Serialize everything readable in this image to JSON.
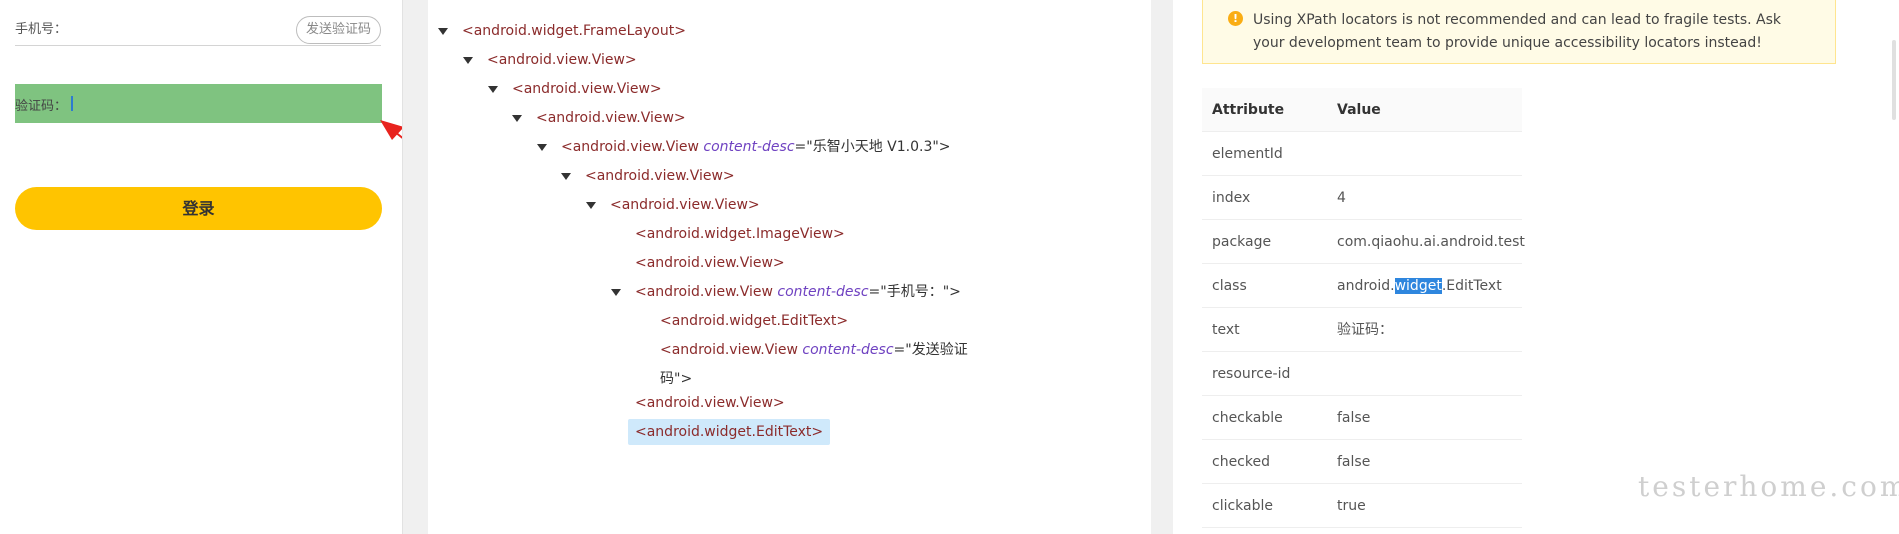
{
  "phone": {
    "phone_label": "手机号：",
    "send_code": "发送验证码",
    "code_label": "验证码：",
    "login": "登录"
  },
  "tree": {
    "rows": [
      {
        "tag": "<android.widget.FrameLayout>"
      },
      {
        "tag": "<android.view.View>"
      },
      {
        "tag": "<android.view.View>"
      },
      {
        "tag": "<android.view.View>"
      },
      {
        "tag_open": "<android.view.View ",
        "attr": "content-desc",
        "eq": "=\"乐智小天地 V1.0.3\">"
      },
      {
        "tag": "<android.view.View>"
      },
      {
        "tag": "<android.view.View>"
      },
      {
        "tag": "<android.widget.ImageView>"
      },
      {
        "tag": "<android.view.View>"
      },
      {
        "tag_open": "<android.view.View ",
        "attr": "content-desc",
        "eq": "=\"手机号：\">"
      },
      {
        "tag": "<android.widget.EditText>"
      },
      {
        "tag_open": "<android.view.View ",
        "attr": "content-desc",
        "eq": "=\"发送验证",
        "eq2": "码\">"
      },
      {
        "tag": "<android.view.View>"
      },
      {
        "tag": "<android.widget.EditText>"
      }
    ]
  },
  "alert": {
    "icon": "!",
    "text": "Using XPath locators is not recommended and can lead to fragile tests. Ask your development team to provide unique accessibility locators instead!"
  },
  "attributes": {
    "header_key": "Attribute",
    "header_value": "Value",
    "rows": [
      {
        "key": "elementId",
        "value": ""
      },
      {
        "key": "index",
        "value": "4"
      },
      {
        "key": "package",
        "value": "com.qiaohu.ai.android.test"
      },
      {
        "key": "class",
        "value_pre": "android.",
        "value_hl": "widget",
        "value_post": ".EditText"
      },
      {
        "key": "text",
        "value": "验证码："
      },
      {
        "key": "resource-id",
        "value": ""
      },
      {
        "key": "checkable",
        "value": "false"
      },
      {
        "key": "checked",
        "value": "false"
      },
      {
        "key": "clickable",
        "value": "true"
      }
    ]
  },
  "watermark": "testerhome.com",
  "colors": {
    "tag": "#8b2b2b",
    "attr": "#6f42c1",
    "selected_bg": "#cfe9fb",
    "code_field_bg": "#7fc380",
    "login_bg": "#ffc400",
    "arrow": "#e8231e"
  }
}
